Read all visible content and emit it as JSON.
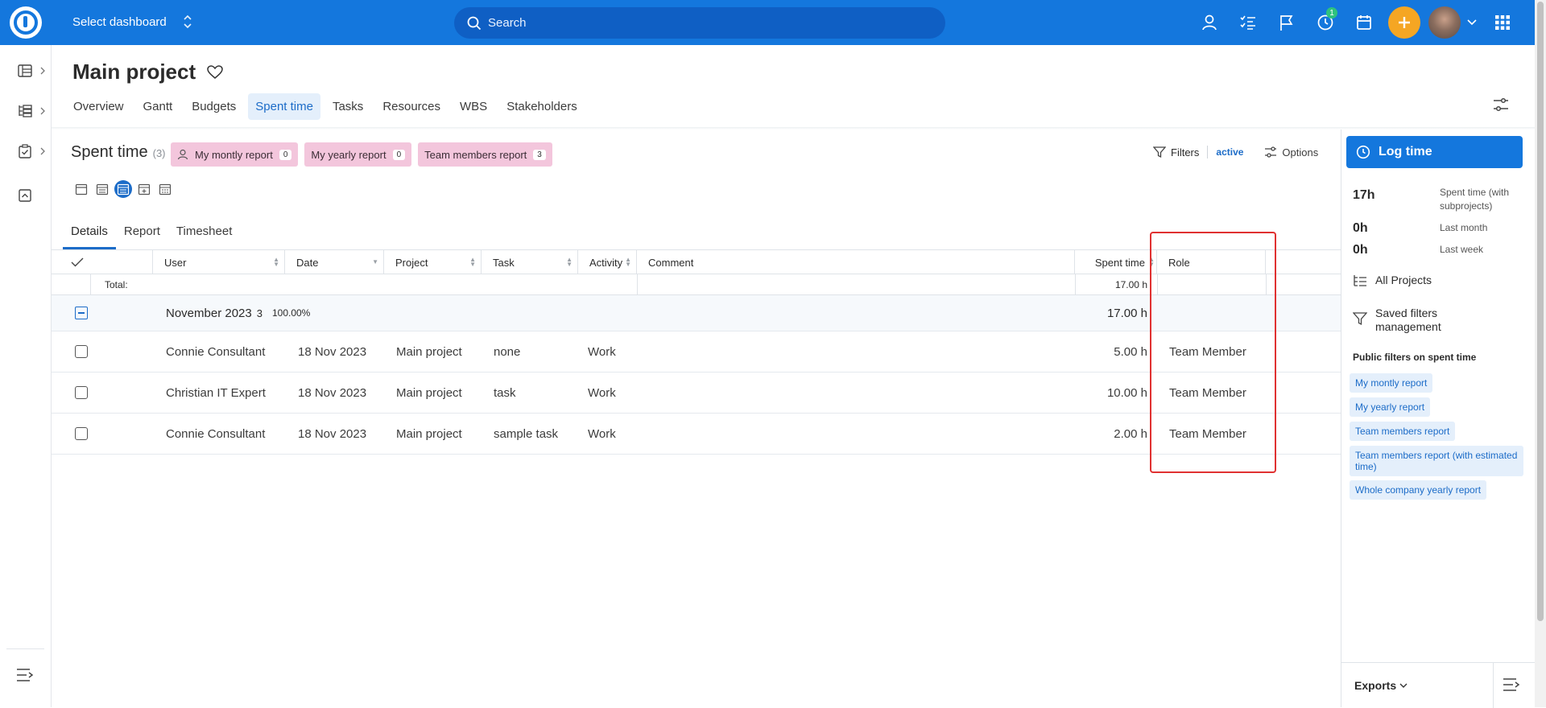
{
  "topbar": {
    "dashboard_label": "Select dashboard",
    "search_placeholder": "Search",
    "timer_badge": "1"
  },
  "page": {
    "title": "Main project",
    "tabs": [
      "Overview",
      "Gantt",
      "Budgets",
      "Spent time",
      "Tasks",
      "Resources",
      "WBS",
      "Stakeholders"
    ],
    "active_tab": "Spent time"
  },
  "spent_time": {
    "title": "Spent time",
    "count": "(3)",
    "chips": [
      {
        "label": "My montly report",
        "count": "0"
      },
      {
        "label": "My yearly report",
        "count": "0"
      },
      {
        "label": "Team members report",
        "count": "3"
      }
    ],
    "filters_label": "Filters",
    "filters_state": "active",
    "options_label": "Options",
    "subtabs": [
      "Details",
      "Report",
      "Timesheet"
    ],
    "active_subtab": "Details"
  },
  "table": {
    "columns": [
      "User",
      "Date",
      "Project",
      "Task",
      "Activity",
      "Comment",
      "Spent time",
      "Role"
    ],
    "total_label": "Total:",
    "total_value": "17.00 h",
    "group": {
      "label": "November 2023",
      "count": "3",
      "percent": "100.00%",
      "value": "17.00 h"
    },
    "rows": [
      {
        "user": "Connie Consultant",
        "date": "18 Nov 2023",
        "project": "Main project",
        "task": "none",
        "activity": "Work",
        "comment": "",
        "spent": "5.00 h",
        "role": "Team Member"
      },
      {
        "user": "Christian IT Expert",
        "date": "18 Nov 2023",
        "project": "Main project",
        "task": "task",
        "activity": "Work",
        "comment": "",
        "spent": "10.00 h",
        "role": "Team Member"
      },
      {
        "user": "Connie Consultant",
        "date": "18 Nov 2023",
        "project": "Main project",
        "task": "sample task",
        "activity": "Work",
        "comment": "",
        "spent": "2.00 h",
        "role": "Team Member"
      }
    ]
  },
  "right_panel": {
    "log_time": "Log time",
    "stats": [
      {
        "value": "17h",
        "label": "Spent time (with subprojects)"
      },
      {
        "value": "0h",
        "label": "Last month"
      },
      {
        "value": "0h",
        "label": "Last week"
      }
    ],
    "all_projects": "All Projects",
    "saved_filters": "Saved filters management",
    "public_filters_title": "Public filters on spent time",
    "public_filters": [
      "My montly report",
      "My yearly report",
      "Team members report",
      "Team members report (with estimated time)",
      "Whole company yearly report"
    ],
    "exports": "Exports"
  }
}
